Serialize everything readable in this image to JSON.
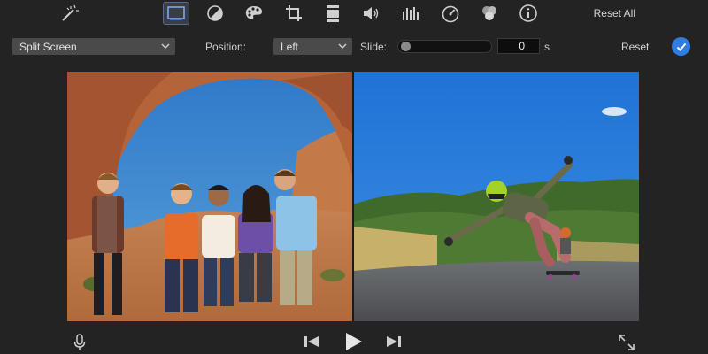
{
  "toolbar": {
    "icons": [
      "magic-wand-icon",
      "video-overlay-icon",
      "color-balance-icon",
      "color-palette-icon",
      "crop-icon",
      "stabilization-icon",
      "volume-icon",
      "equalizer-icon",
      "speed-icon",
      "noise-reduction-icon",
      "info-icon"
    ],
    "active_icon": "video-overlay-icon",
    "reset_all_label": "Reset All"
  },
  "overlay": {
    "style": "Split Screen",
    "position_label": "Position:",
    "position_value": "Left",
    "slide_label": "Slide:",
    "slide_value": "0",
    "slide_unit": "s",
    "slide_level": 0,
    "reset_label": "Reset"
  },
  "viewer": {
    "left_clip": "group-under-rock-arch",
    "right_clip": "downhill-skateboarder"
  },
  "playback": {
    "icons": [
      "microphone-icon",
      "skip-back-icon",
      "play-icon",
      "skip-forward-icon",
      "fullscreen-icon"
    ]
  },
  "colors": {
    "background": "#232323",
    "accent": "#2f7de1",
    "control_bg": "#4a4a4a"
  }
}
